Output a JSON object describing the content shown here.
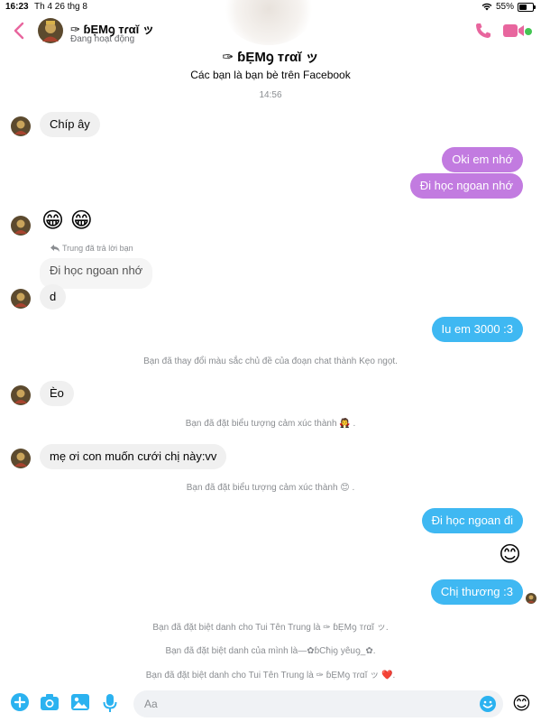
{
  "status_bar": {
    "time": "16:23",
    "date": "Th 4 26 thg 8",
    "battery": "55%",
    "battery_level": 0.55
  },
  "header": {
    "contact_name": "✑ ɓẸMꝯ тɾαĭ ッ",
    "status": "Đang hoạt động"
  },
  "profile": {
    "name": "✑ ɓẸMꝯ тɾαĭ ッ",
    "subtitle": "Các bạn là bạn bè trên Facebook"
  },
  "timestamp": "14:56",
  "messages": {
    "m1": "Chíp ây",
    "m2": "Oki em nhớ",
    "m3": "Đi học ngoan nhớ",
    "m4_emoji": "😁 😁",
    "reply_note": "Trung đã trả lời bạn",
    "m5_quoted": "Đi học ngoan nhớ",
    "m6": "d",
    "m7": "Iu em 3000 :3",
    "sys1": "Bạn đã thay đổi màu sắc chủ đề của đoạn chat thành Kẹo ngọt.",
    "m8": "Èo",
    "sys2": "Bạn đã đặt biểu tượng cảm xúc thành 🧛 .",
    "m9": "mẹ ơi con muốn cưới chị này:vv",
    "sys3": "Bạn đã đặt biểu tượng cảm xúc thành 😊 .",
    "m10": "Đi học ngoan đi",
    "m11_emoji": "😊",
    "m12": "Chị thương :3",
    "sys4": "Bạn đã đặt biệt danh cho Tui Tên Trung là ✑ ɓẸMꝯ тɾαĭ ッ.",
    "sys5": "Bạn đã đặt biệt danh của mình là—✿ɓCħịꝯ yêuꝯ_✿.",
    "sys6": "Bạn đã đặt biệt danh cho Tui Tên Trung là ✑ ɓẸMꝯ тɾαĭ ッ ❤️."
  },
  "composer": {
    "placeholder": "Aa",
    "quick_emoji": "😊"
  },
  "colors": {
    "accent_pink": "#c27be0",
    "accent_blue": "#3fb8f2",
    "icon_blue": "#2bb2f0",
    "call_pink": "#e8669e"
  },
  "icons": [
    "back-icon",
    "phone-icon",
    "video-icon",
    "plus-icon",
    "camera-icon",
    "image-icon",
    "mic-icon",
    "emoji-icon",
    "reply-icon"
  ]
}
